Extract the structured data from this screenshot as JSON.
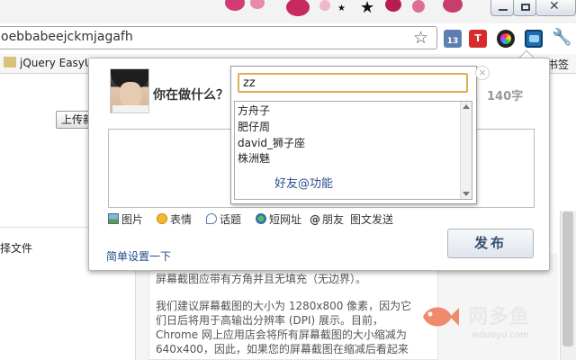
{
  "browser": {
    "url": "oebbabeejckmjagafh",
    "window_controls": {
      "minimize": "minimize-icon",
      "maximize": "maximize-icon",
      "close": "close-icon"
    },
    "extensions": [
      {
        "name": "calendar-extension-icon",
        "label": "13",
        "color": "#5c7fb0"
      },
      {
        "name": "t-extension-icon",
        "label": "T",
        "color": "#d62b2b"
      },
      {
        "name": "color-wheel-extension-icon",
        "label": "",
        "color": "#222222"
      },
      {
        "name": "weibo-extension-icon",
        "label": "",
        "color": "#1d6fb3"
      },
      {
        "name": "wrench-icon",
        "label": "",
        "color": "#555555"
      }
    ]
  },
  "bookmarks": {
    "left": "jQuery EasyUI",
    "right": "书签"
  },
  "page": {
    "upload_button": "上传新",
    "side_text": "择文件",
    "paragraph_lines": [
      "屏幕截图应带有方角并且无填充（无边界）。",
      "我们建议屏幕截图的大小为 1280x800 像素，因为它",
      "们日后将用于高输出分辨率 (DPI) 展示。目前，",
      "Chrome 网上应用店会将所有屏幕截图的大小缩减为",
      "640x400，因此，如果您的屏幕截图在缩减后看起来"
    ]
  },
  "watermark": {
    "text": "网多鱼",
    "sub": "wduoyu.com"
  },
  "popup": {
    "question": "你在做什么？",
    "counter_prefix": "",
    "counter_value": "140字",
    "compose_text": "",
    "toolbar": [
      {
        "icon": "picture-icon",
        "label": "图片"
      },
      {
        "icon": "emoticon-icon",
        "label": "表情"
      },
      {
        "icon": "topic-icon",
        "label": "话题"
      },
      {
        "icon": "short-url-icon",
        "label": "短网址"
      },
      {
        "icon": "at-icon",
        "label": "朋友"
      },
      {
        "icon": "",
        "label": "图文发送"
      }
    ],
    "settings_link": "简单设置一下",
    "publish_button": "发布"
  },
  "friend_dropdown": {
    "input_value": "zz",
    "friends": [
      "方舟子",
      "肥仔周",
      "david_狮子座",
      "株洲魅"
    ],
    "hint": "好友@功能",
    "close_glyph": "×"
  },
  "colors": {
    "accent_input_border": "#d9b055",
    "publish_text": "#35506f",
    "link": "#224b8c"
  }
}
